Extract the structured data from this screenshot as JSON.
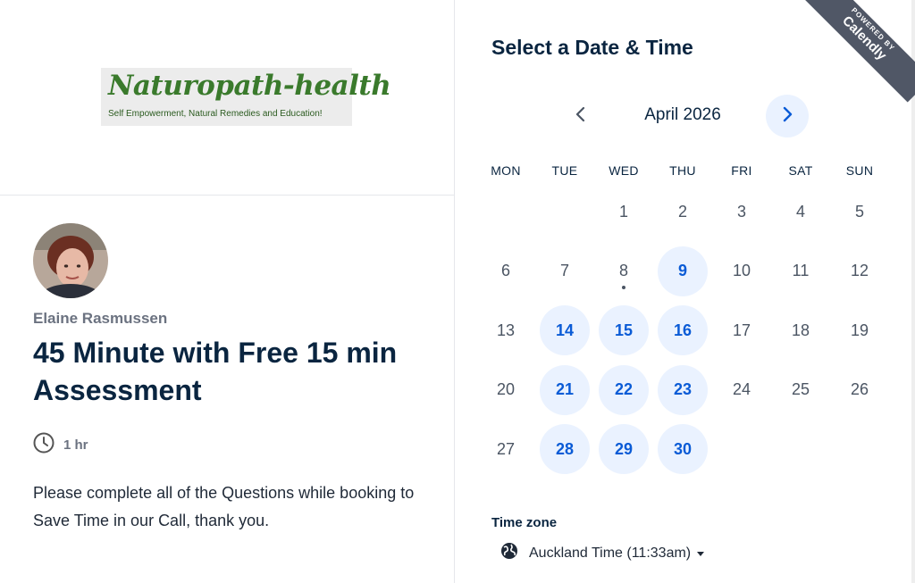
{
  "logo": {
    "title": "Naturopath-health",
    "tagline": "Self Empowerment, Natural Remedies and Education!"
  },
  "event": {
    "host": "Elaine Rasmussen",
    "title": "45 Minute with Free 15 min Assessment",
    "duration": "1 hr",
    "description": "Please complete all of the Questions while booking to Save Time in our Call, thank you."
  },
  "calendar": {
    "heading": "Select a Date & Time",
    "month": "April 2026",
    "weekdays": [
      "MON",
      "TUE",
      "WED",
      "THU",
      "FRI",
      "SAT",
      "SUN"
    ],
    "first_weekday_index": 2,
    "days_in_month": 30,
    "available_days": [
      9,
      14,
      15,
      16,
      21,
      22,
      23,
      28,
      29,
      30
    ],
    "today": 8
  },
  "timezone": {
    "label": "Time zone",
    "value": "Auckland Time (11:33am)"
  },
  "badge": {
    "small": "POWERED BY",
    "brand": "Calendly"
  },
  "colors": {
    "accent": "#0a5bd6",
    "available_bg": "#eaf2ff",
    "title": "#0a2540",
    "logo_green": "#3a7a2c",
    "badge_bg": "#505766"
  },
  "icons": {
    "duration": "clock-icon",
    "timezone": "globe-icon",
    "prev": "chevron-left-icon",
    "next": "chevron-right-icon",
    "dropdown": "caret-down-icon"
  }
}
